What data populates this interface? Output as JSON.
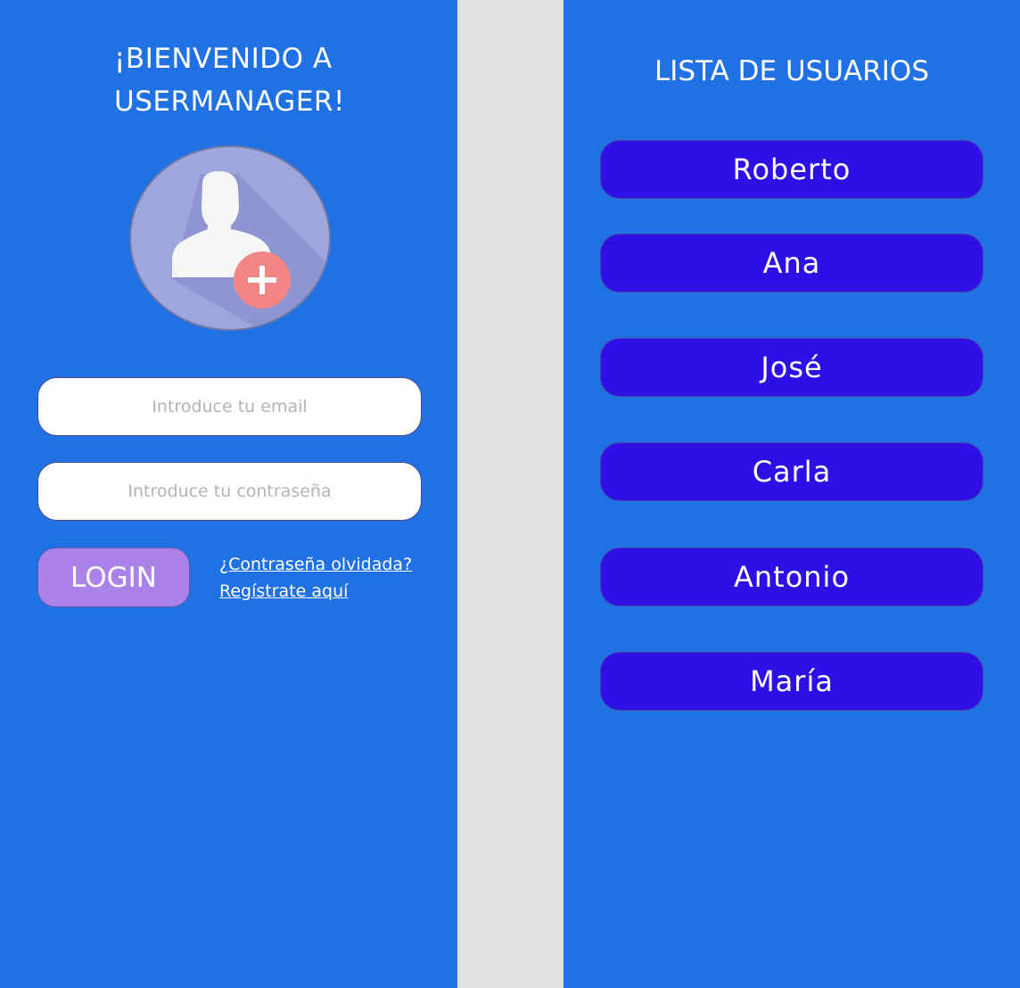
{
  "login": {
    "title_line1": "¡BIENVENIDO A",
    "title_line2": "USERMANAGER!",
    "email_placeholder": "Introduce tu email",
    "password_placeholder": "Introduce tu contraseña",
    "login_label": "LOGIN",
    "forgot_link": "¿Contraseña olvidada?",
    "register_link": "Regístrate aquí",
    "avatar_icon": "add-user-icon"
  },
  "user_list": {
    "title": "LISTA DE USUARIOS",
    "users": [
      "Roberto",
      "Ana",
      "José",
      "Carla",
      "Antonio",
      "María"
    ]
  },
  "colors": {
    "panel_bg": "#1f71e4",
    "divider_bg": "#e2e2e2",
    "user_button": "#2e0fe6",
    "login_button": "#ab82e8",
    "avatar_bg": "#9ea7dd",
    "plus_badge": "#f48585"
  }
}
